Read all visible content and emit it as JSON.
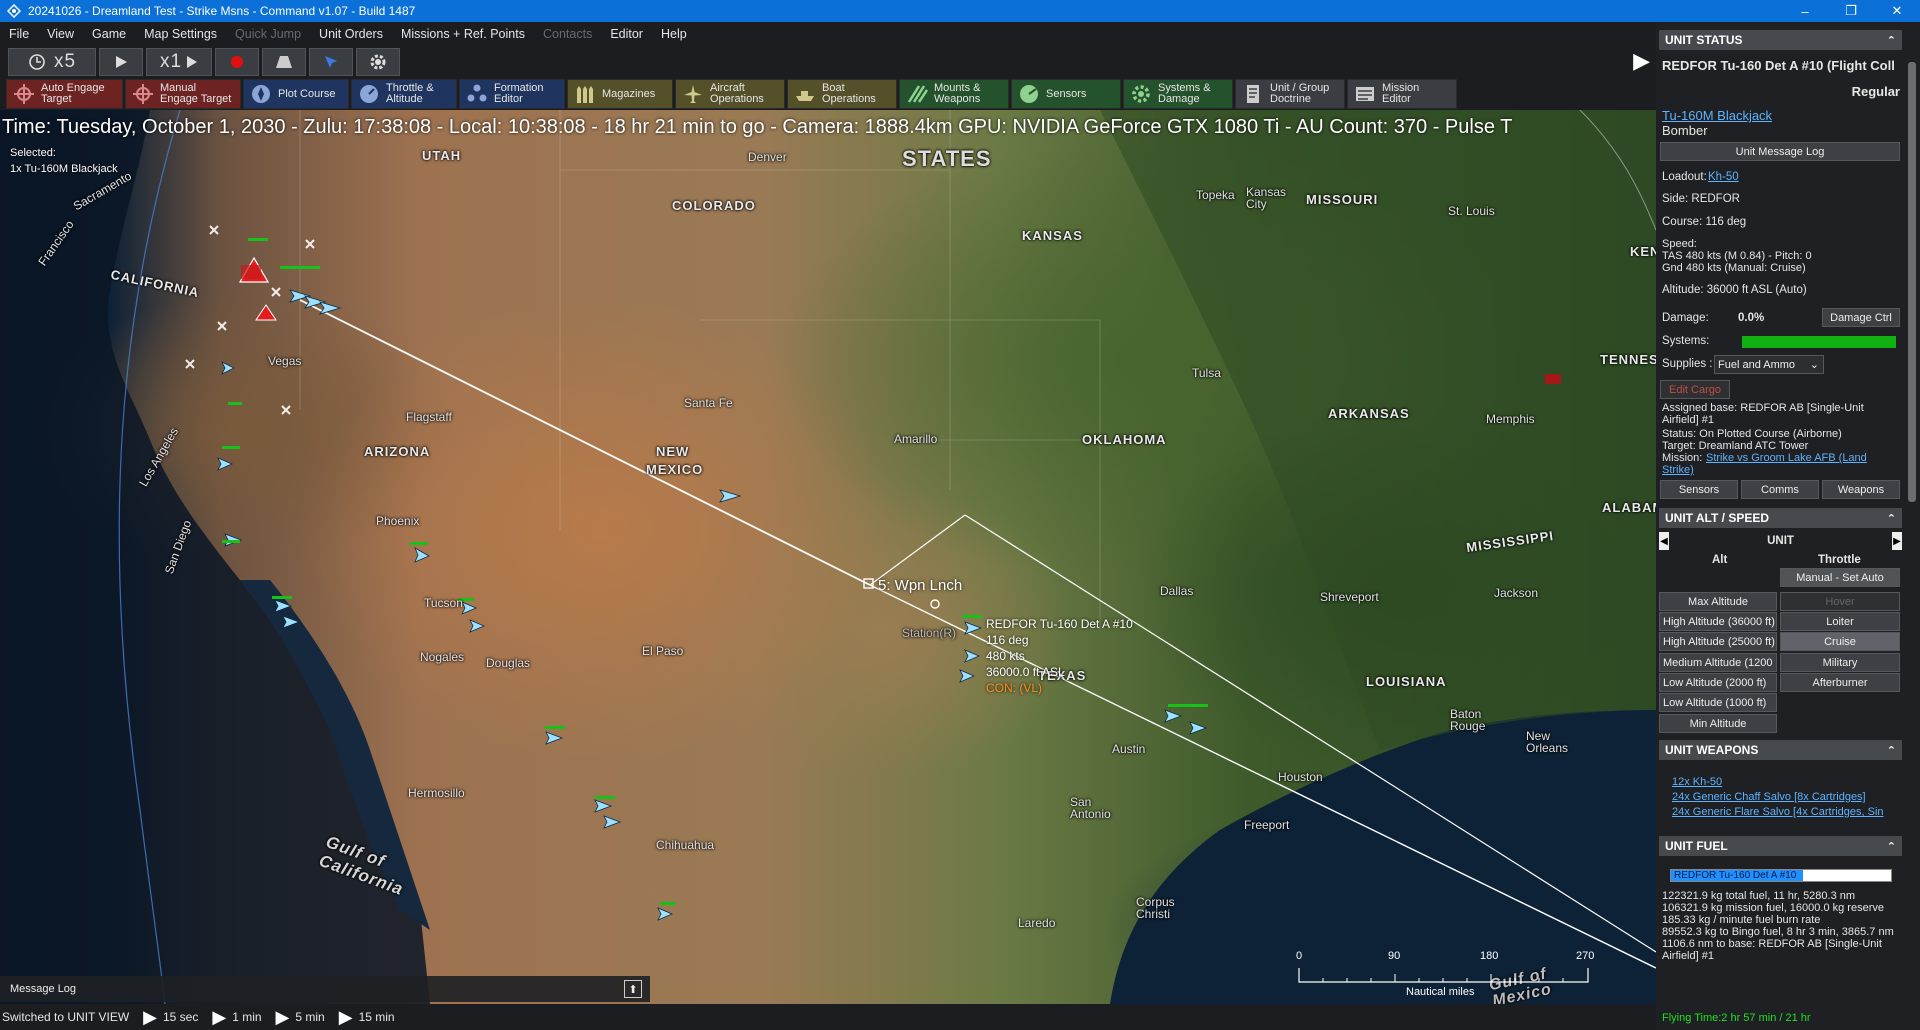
{
  "window": {
    "title": "20241026 - Dreamland Test - Strike Msns - Command v1.07 - Build 1487",
    "minimize": "–",
    "maximize": "❐",
    "close": "✕"
  },
  "menu": [
    "File",
    "View",
    "Game",
    "Map Settings",
    "Quick Jump",
    "Unit Orders",
    "Missions + Ref. Points",
    "Contacts",
    "Editor",
    "Help"
  ],
  "menu_disabled": [
    "Quick Jump",
    "Contacts"
  ],
  "timebar": {
    "compression": "x5",
    "speed": "x1"
  },
  "commands": [
    {
      "label1": "Auto Engage",
      "label2": "Target",
      "color": "red",
      "icon": "crosshair-icon"
    },
    {
      "label1": "Manual",
      "label2": "Engage Target",
      "color": "red",
      "icon": "crosshair-icon"
    },
    {
      "label1": "Plot Course",
      "label2": "",
      "color": "blue",
      "icon": "compass-icon"
    },
    {
      "label1": "Throttle &",
      "label2": "Altitude",
      "color": "blue",
      "icon": "throttle-icon"
    },
    {
      "label1": "Formation",
      "label2": "Editor",
      "color": "blue",
      "icon": "formation-icon"
    },
    {
      "label1": "Magazines",
      "label2": "",
      "color": "olive",
      "icon": "magazine-icon"
    },
    {
      "label1": "Aircraft",
      "label2": "Operations",
      "color": "olive",
      "icon": "aircraft-icon"
    },
    {
      "label1": "Boat",
      "label2": "Operations",
      "color": "olive",
      "icon": "boat-icon"
    },
    {
      "label1": "Mounts &",
      "label2": "Weapons",
      "color": "green",
      "icon": "mounts-icon"
    },
    {
      "label1": "Sensors",
      "label2": "",
      "color": "green",
      "icon": "sensor-icon"
    },
    {
      "label1": "Systems &",
      "label2": "Damage",
      "color": "green",
      "icon": "gear-icon"
    },
    {
      "label1": "Unit / Group",
      "label2": "Doctrine",
      "color": "gray",
      "icon": "doctrine-icon"
    },
    {
      "label1": "Mission",
      "label2": "Editor",
      "color": "gray",
      "icon": "mission-icon"
    }
  ],
  "map": {
    "status": "Time: Tuesday, October 1, 2030 - Zulu: 17:38:08 - Local: 10:38:08 - 18 hr 21 min to go - Camera: 1888.4km GPU: NVIDIA GeForce GTX 1080 Ti - AU Count: 370 - Pulse T",
    "selected_title": "Selected:",
    "selected_unit": "1x Tu-160M Blackjack",
    "regions": [
      "STATES",
      "UTAH",
      "COLORADO",
      "KANSAS",
      "MISSOURI",
      "CALIFORNIA",
      "ARIZONA",
      "NEW",
      "MEXICO",
      "OKLAHOMA",
      "ARKANSAS",
      "TEXAS",
      "MISSISSIPPI",
      "LOUISIANA",
      "ALABAM",
      "TENNES",
      "KEN"
    ],
    "cities": [
      "Denver",
      "Topeka",
      "Kansas City",
      "St. Louis",
      "Tulsa",
      "Memphis",
      "Santa Fe",
      "Amarillo",
      "Flagstaff",
      "Phoenix",
      "Tucson",
      "Nogales",
      "Douglas",
      "El Paso",
      "Dallas",
      "Shreveport",
      "Jackson",
      "Austin",
      "Houston",
      "Baton Rouge",
      "New Orleans",
      "San Antonio",
      "Freeport",
      "Corpus Christi",
      "Laredo",
      "Chihuahua",
      "Hermosillo",
      "Los Angeles",
      "San Diego",
      "Vegas",
      "Francisco",
      "Sacramento",
      "Station(R)"
    ],
    "gulfs": [
      "Gulf of California",
      "Gulf of Mexico"
    ],
    "waypoint": "5: Wpn Lnch",
    "unit_info": [
      "REDFOR Tu-160 Det A #10",
      "116 deg",
      "480 kts",
      "36000.0 ft ASL"
    ],
    "unit_con": "CON: (VL)",
    "scale_ticks": [
      "0",
      "90",
      "180",
      "270"
    ],
    "scale_unit": "Nautical miles"
  },
  "msglog": "Message Log",
  "bottom": {
    "status": "Switched to UNIT VIEW",
    "steps": [
      "15 sec",
      "1 min",
      "5 min",
      "15 min"
    ]
  },
  "panel": {
    "unit_status": {
      "header": "UNIT STATUS",
      "name": "REDFOR Tu-160 Det A #10 (Flight Coll",
      "proficiency": "Regular",
      "class_link": "Tu-160M Blackjack",
      "type": "Bomber",
      "message_log_btn": "Unit Message Log",
      "loadout_label": "Loadout:",
      "loadout_link": "Kh-50",
      "side": "Side: REDFOR",
      "course": "Course: 116 deg",
      "speed_label": "Speed:",
      "tas": "TAS 480 kts (M 0.84) - Pitch: 0",
      "gnd": "Gnd 480 kts (Manual: Cruise)",
      "altitude": "Altitude: 36000 ft ASL (Auto)",
      "damage_label": "Damage:",
      "damage_value": "0.0%",
      "damage_btn": "Damage Ctrl",
      "systems_label": "Systems:",
      "systems_level": 1.0,
      "supplies_label": "Supplies :",
      "supplies_value": "Fuel and Ammo",
      "edit_cargo": "Edit Cargo",
      "assigned_base": "Assigned base: REDFOR AB [Single-Unit Airfield] #1",
      "status": "Status: On Plotted Course (Airborne)",
      "target": "Target: Dreamland ATC Tower",
      "mission_label": "Mission:",
      "mission_link": "Strike vs Groom Lake AFB (Land Strike)",
      "tabs": [
        "Sensors",
        "Comms",
        "Weapons"
      ]
    },
    "alt_speed": {
      "header": "UNIT ALT / SPEED",
      "unit_label": "UNIT",
      "alt_label": "Alt",
      "throttle_label": "Throttle",
      "manual_btn": "Manual - Set Auto",
      "alt_buttons": [
        "Max Altitude",
        "High Altitude (36000 ft)",
        "High Altitude (25000 ft)",
        "Medium Altitude (1200",
        "Low Altitude (2000 ft)",
        "Low Altitude (1000 ft)",
        "Min Altitude"
      ],
      "throttle_buttons": [
        "Hover",
        "Loiter",
        "Cruise",
        "Military",
        "Afterburner"
      ]
    },
    "weapons": {
      "header": "UNIT WEAPONS",
      "items": [
        "12x Kh-50",
        "24x Generic Chaff Salvo [8x Cartridges]",
        "24x Generic Flare Salvo [4x Cartridges, Sin"
      ]
    },
    "fuel": {
      "header": "UNIT FUEL",
      "bar_label": "REDFOR Tu-160 Det A #10",
      "bar_level": 0.6,
      "lines": [
        "122321.9 kg total fuel, 11 hr, 5280.3 nm",
        "106321.9 kg mission fuel, 16000.0 kg reserve",
        "185.33 kg / minute fuel burn rate",
        "89552.3 kg to Bingo fuel, 8 hr 3 min, 3865.7 nm",
        "1106.6 nm to base: REDFOR AB [Single-Unit Airfield] #1"
      ],
      "flying_time": "Flying Time:2 hr 57 min / 21 hr"
    }
  },
  "colors": {
    "titlebar": "#0b71d9",
    "link": "#5fb3ff",
    "systems_bar": "#10b010",
    "fuel_bar": "#1e90ff",
    "con": "#ff8c1a"
  }
}
